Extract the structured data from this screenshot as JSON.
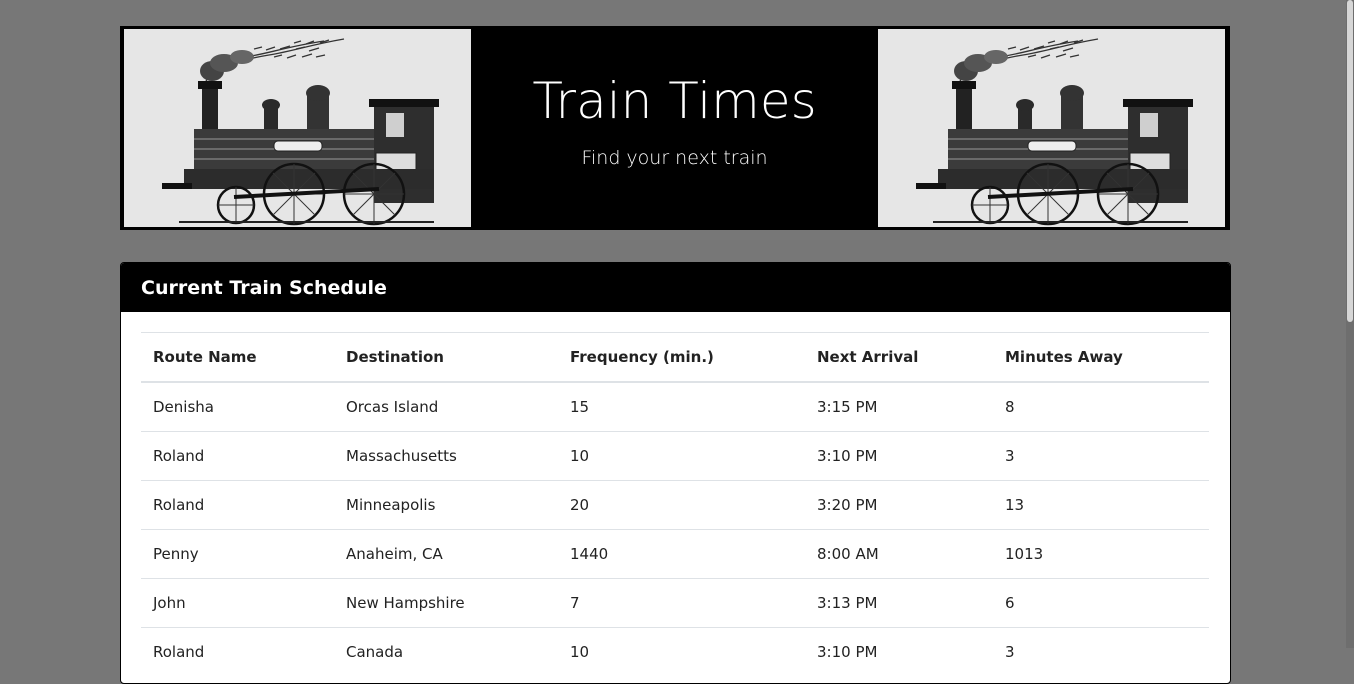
{
  "header": {
    "title": "Train Times",
    "subtitle": "Find your next train"
  },
  "schedule": {
    "heading": "Current Train Schedule",
    "columns": [
      "Route Name",
      "Destination",
      "Frequency (min.)",
      "Next Arrival",
      "Minutes Away"
    ],
    "rows": [
      [
        "Denisha",
        "Orcas Island",
        "15",
        "3:15 PM",
        "8"
      ],
      [
        "Roland",
        "Massachusetts",
        "10",
        "3:10 PM",
        "3"
      ],
      [
        "Roland",
        "Minneapolis",
        "20",
        "3:20 PM",
        "13"
      ],
      [
        "Penny",
        "Anaheim, CA",
        "1440",
        "8:00 AM",
        "1013"
      ],
      [
        "John",
        "New Hampshire",
        "7",
        "3:13 PM",
        "6"
      ],
      [
        "Roland",
        "Canada",
        "10",
        "3:10 PM",
        "3"
      ]
    ]
  },
  "icons": {
    "banner_left": "steam-locomotive-illustration",
    "banner_right": "steam-locomotive-illustration"
  }
}
